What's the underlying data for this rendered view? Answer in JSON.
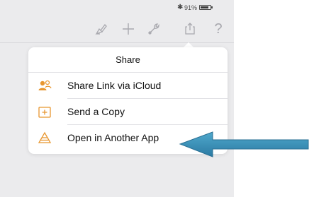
{
  "status_bar": {
    "bluetooth_icon": "bluetooth-icon",
    "battery_percent": "91%",
    "battery_icon": "battery-icon"
  },
  "toolbar": {
    "icons": [
      "paintbrush-icon",
      "plus-icon",
      "wrench-icon",
      "share-icon",
      "help-icon"
    ],
    "help_glyph": "?"
  },
  "share_popover": {
    "title": "Share",
    "items": [
      {
        "label": "Share Link via iCloud",
        "icon": "share-link-icloud-icon"
      },
      {
        "label": "Send a Copy",
        "icon": "send-copy-icon"
      },
      {
        "label": "Open in Another App",
        "icon": "open-in-app-icon"
      }
    ]
  },
  "colors": {
    "accent_orange": "#e8962f",
    "callout_arrow": "#3a8fb5",
    "toolbar_icon": "#a8a8ae",
    "background": "#ebebed"
  }
}
